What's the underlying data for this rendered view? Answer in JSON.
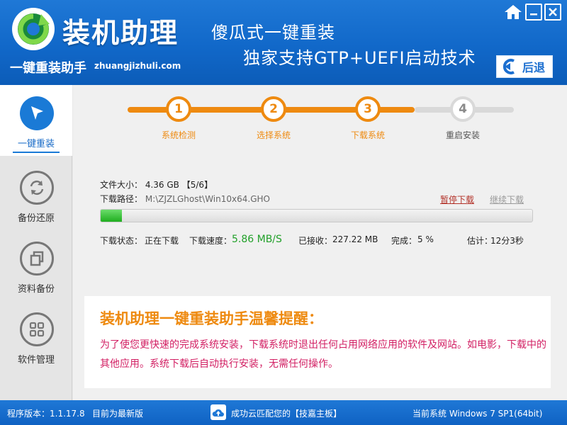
{
  "header": {
    "brand": "装机助理",
    "subtitle": "一键重装助手",
    "url": "zhuangjizhuli.com",
    "slogan_line1": "傻瓜式一键重装",
    "slogan_line2": "独家支持GTP+UEFI启动技术",
    "back_label": "后退"
  },
  "window_controls": [
    "home-icon",
    "minimize-icon",
    "close-icon"
  ],
  "sidebar": {
    "items": [
      {
        "label": "一键重装",
        "icon": "cursor-arrow-icon",
        "active": true
      },
      {
        "label": "备份还原",
        "icon": "sync-arrows-icon",
        "active": false
      },
      {
        "label": "资料备份",
        "icon": "copy-icon",
        "active": false
      },
      {
        "label": "软件管理",
        "icon": "grid-icon",
        "active": false
      }
    ]
  },
  "steps": [
    {
      "num": "1",
      "label": "系统检测",
      "state": "done"
    },
    {
      "num": "2",
      "label": "选择系统",
      "state": "done"
    },
    {
      "num": "3",
      "label": "下载系统",
      "state": "done"
    },
    {
      "num": "4",
      "label": "重启安装",
      "state": "todo"
    }
  ],
  "download": {
    "size_label": "文件大小：",
    "size_value": "4.36 GB",
    "size_part": "【5/6】",
    "path_label": "下载路径：",
    "path_value": "M:\\ZJZLGhost\\Win10x64.GHO",
    "pause_label": "暂停下载",
    "resume_label": "继续下载",
    "progress_percent": 5,
    "status_label": "下载状态：",
    "status_value": "正在下载",
    "speed_label": "下载速度：",
    "speed_value": "5.86 MB/S",
    "received_label": "已接收：",
    "received_value": "227.22 MB",
    "complete_label": "完成：",
    "complete_value": "5 %",
    "eta_label": "估计：",
    "eta_value": "12分3秒"
  },
  "notice": {
    "title": "装机助理一键重装助手温馨提醒：",
    "body": "为了使您更快速的完成系统安装，下载系统时退出任何占用网络应用的软件及网站。如电影，下载中的其他应用。系统下载后自动执行安装，无需任何操作。"
  },
  "statusbar": {
    "version": "程序版本：1.1.17.8",
    "version_note": "目前为最新版",
    "cloud_text": "成功云匹配您的【技嘉主板】",
    "system": "当前系统 Windows 7 SP1(64bit)"
  },
  "colors": {
    "header_blue": "#1168c9",
    "step_orange": "#ee8a10",
    "progress_green": "#22a02a",
    "notice_pink": "#d21f63"
  }
}
